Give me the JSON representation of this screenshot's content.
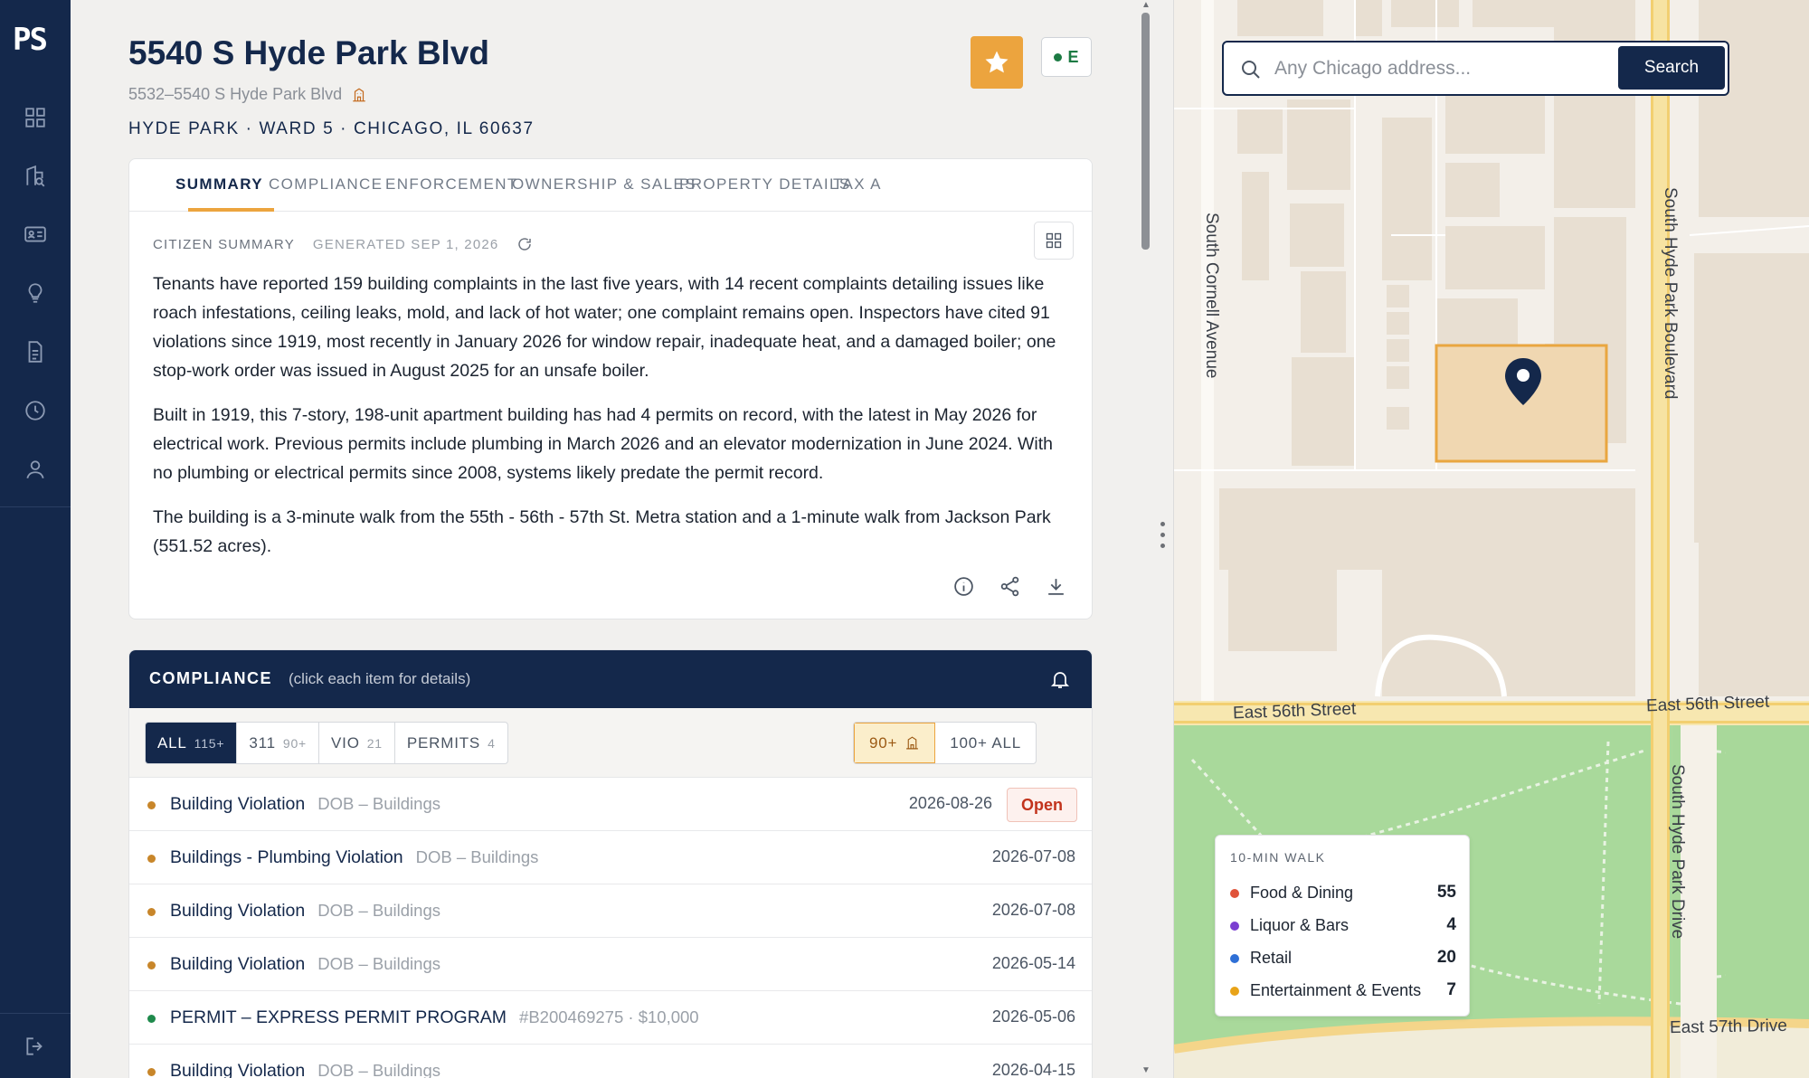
{
  "sidebar": {
    "logo": "PS"
  },
  "property": {
    "title": "5540 S Hyde Park Blvd",
    "address_range": "5532–5540 S Hyde Park Blvd",
    "location_line": "HYDE PARK · WARD 5 · CHICAGO, IL 60637",
    "energy_grade": "E"
  },
  "tabs": [
    "SUMMARY",
    "COMPLIANCE",
    "ENFORCEMENT",
    "OWNERSHIP & SALES",
    "PROPERTY DETAILS",
    "TAX A"
  ],
  "summary": {
    "label": "CITIZEN SUMMARY",
    "generated": "GENERATED SEP 1, 2026",
    "paragraphs": [
      "Tenants have reported 159 building complaints in the last five years, with 14 recent complaints detailing issues like roach infestations, ceiling leaks, mold, and lack of hot water; one complaint remains open. Inspectors have cited 91 violations since 1919, most recently in January 2026 for window repair, inadequate heat, and a damaged boiler; one stop-work order was issued in August 2025 for an unsafe boiler.",
      "Built in 1919, this 7-story, 198-unit apartment building has had 4 permits on record, with the latest in May 2026 for electrical work. Previous permits include plumbing in March 2026 and an elevator modernization in June 2024. With no plumbing or electrical permits since 2008, systems likely predate the permit record.",
      "The building is a 3-minute walk from the 55th - 56th - 57th St. Metra station and a 1-minute walk from Jackson Park (551.52 acres)."
    ]
  },
  "compliance": {
    "title": "COMPLIANCE",
    "hint": "(click each item for details)",
    "filters": [
      {
        "label": "ALL",
        "count": "115+"
      },
      {
        "label": "311",
        "count": "90+"
      },
      {
        "label": "VIO",
        "count": "21"
      },
      {
        "label": "PERMITS",
        "count": "4"
      }
    ],
    "range_filters": [
      "90+",
      "100+ ALL"
    ],
    "items": [
      {
        "title": "Building Violation",
        "source": "DOB – Buildings",
        "date": "2026-08-26",
        "status": "Open"
      },
      {
        "title": "Buildings - Plumbing Violation",
        "source": "DOB – Buildings",
        "date": "2026-07-08",
        "status": ""
      },
      {
        "title": "Building Violation",
        "source": "DOB – Buildings",
        "date": "2026-07-08",
        "status": ""
      },
      {
        "title": "Building Violation",
        "source": "DOB – Buildings",
        "date": "2026-05-14",
        "status": ""
      },
      {
        "title": "PERMIT – EXPRESS PERMIT PROGRAM",
        "source": "#B200469275 · $10,000",
        "date": "2026-05-06",
        "status": ""
      },
      {
        "title": "Building Violation",
        "source": "DOB – Buildings",
        "date": "2026-04-15",
        "status": ""
      }
    ]
  },
  "map": {
    "search_placeholder": "Any Chicago address...",
    "search_button": "Search",
    "streets": {
      "cornell": "South Cornell Avenue",
      "hyde_park_blvd": "South Hyde Park Boulevard",
      "e56_left": "East 56th Street",
      "e56_right": "East 56th Street",
      "hyde_park_dr": "South Hyde Park Drive",
      "e57": "East 57th Drive"
    },
    "walk": {
      "title": "10-MIN WALK",
      "items": [
        {
          "label": "Food & Dining",
          "count": "55",
          "color": "#e0533a"
        },
        {
          "label": "Liquor & Bars",
          "count": "4",
          "color": "#7b3fd1"
        },
        {
          "label": "Retail",
          "count": "20",
          "color": "#2e6fd6"
        },
        {
          "label": "Entertainment & Events",
          "count": "7",
          "color": "#e8a318"
        }
      ]
    }
  }
}
